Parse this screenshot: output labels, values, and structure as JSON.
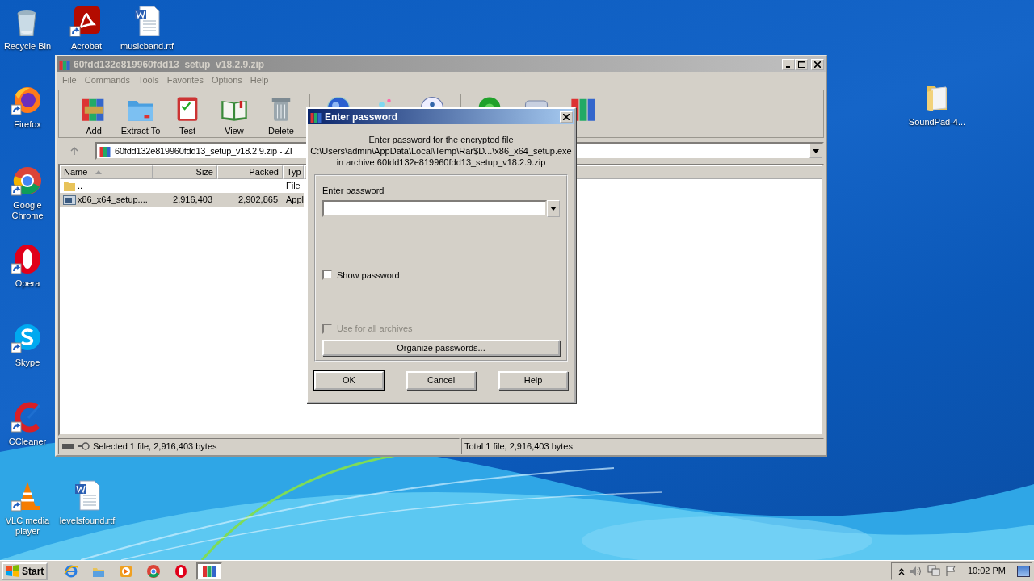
{
  "desktop": {
    "icons": [
      {
        "label": "Recycle Bin",
        "kind": "recycle",
        "shortcut": false
      },
      {
        "label": "Acrobat",
        "kind": "pdf",
        "shortcut": true
      },
      {
        "label": "musicband.rtf",
        "kind": "word",
        "shortcut": false
      },
      {
        "label": "Firefox",
        "kind": "firefox",
        "shortcut": true
      },
      {
        "label": "Google Chrome",
        "kind": "chrome",
        "shortcut": true
      },
      {
        "label": "Opera",
        "kind": "opera",
        "shortcut": true
      },
      {
        "label": "Skype",
        "kind": "skype",
        "shortcut": true
      },
      {
        "label": "CCleaner",
        "kind": "ccleaner",
        "shortcut": true
      },
      {
        "label": "VLC media player",
        "kind": "vlc",
        "shortcut": true
      },
      {
        "label": "levelsfound.rtf",
        "kind": "word",
        "shortcut": false
      },
      {
        "label": "SoundPad-4...",
        "kind": "folder",
        "shortcut": false
      }
    ]
  },
  "archive_window": {
    "title": "60fdd132e819960fdd13_setup_v18.2.9.zip",
    "menu": [
      "File",
      "Commands",
      "Tools",
      "Favorites",
      "Options",
      "Help"
    ],
    "toolbar": [
      {
        "label": "Add",
        "kind": "add"
      },
      {
        "label": "Extract To",
        "kind": "extract"
      },
      {
        "label": "Test",
        "kind": "test"
      },
      {
        "label": "View",
        "kind": "view"
      },
      {
        "label": "Delete",
        "kind": "delete"
      },
      {
        "kind": "find"
      },
      {
        "kind": "wizard"
      },
      {
        "kind": "info"
      },
      {
        "kind": "scan"
      },
      {
        "kind": "comment"
      },
      {
        "kind": "sfx"
      }
    ],
    "address": "60fdd132e819960fdd13_setup_v18.2.9.zip - ZI",
    "columns": [
      {
        "label": "Name",
        "sorted": true
      },
      {
        "label": "Size"
      },
      {
        "label": "Packed"
      },
      {
        "label": "Typ"
      }
    ],
    "rows": [
      {
        "kind": "folder",
        "name": "..",
        "type": "File",
        "selected": false
      },
      {
        "kind": "exe",
        "name": "x86_x64_setup....",
        "size": "2,916,403",
        "packed": "2,902,865",
        "type": "Appl",
        "selected": true
      }
    ],
    "status": [
      "Selected 1 file, 2,916,403 bytes",
      "Total 1 file, 2,916,403 bytes"
    ]
  },
  "password_dialog": {
    "title": "Enter password",
    "message": [
      "Enter password for the encrypted file",
      "C:\\Users\\admin\\AppData\\Local\\Temp\\Rar$D...\\x86_x64_setup.exe",
      "in archive 60fdd132e819960fdd13_setup_v18.2.9.zip"
    ],
    "field_label": "Enter password",
    "checkboxes": [
      {
        "label": "Show password",
        "checked": false,
        "disabled": false
      },
      {
        "label": "Use for all archives",
        "checked": false,
        "disabled": true
      }
    ],
    "organize_button": "Organize passwords...",
    "buttons": [
      {
        "label": "OK",
        "default": true
      },
      {
        "label": "Cancel",
        "default": false
      },
      {
        "label": "Help",
        "default": false
      }
    ]
  },
  "taskbar": {
    "start": "Start",
    "items": [
      {
        "kind": "ie",
        "active": false
      },
      {
        "kind": "explorer",
        "active": false
      },
      {
        "kind": "media",
        "active": false
      },
      {
        "kind": "chrome",
        "active": false
      },
      {
        "kind": "opera",
        "active": false
      },
      {
        "kind": "winrar",
        "active": true
      }
    ],
    "clock": "10:02 PM"
  }
}
